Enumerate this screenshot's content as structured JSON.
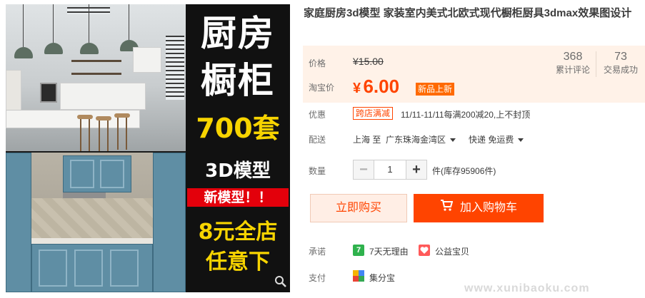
{
  "gallery": {
    "banner_line1": "厨房",
    "banner_line2": "橱柜",
    "banner_count": "700套",
    "banner_model": "3D模型",
    "banner_new": "新模型！！",
    "banner_sale1": "8元全店",
    "banner_sale2": "任意下"
  },
  "product": {
    "title": "家庭厨房3d模型 家装室内美式北欧式现代橱柜厨具3dmax效果图设计"
  },
  "price": {
    "label_price": "价格",
    "original": "¥15.00",
    "label_promo": "淘宝价",
    "promo_currency": "¥",
    "promo_value": "6.00",
    "new_badge": "新品上新",
    "reviews_count": "368",
    "reviews_label": "累计评论",
    "sales_count": "73",
    "sales_label": "交易成功"
  },
  "promotion": {
    "label": "优惠",
    "tag": "跨店满减",
    "desc": "11/11-11/11每满200减20,上不封顶"
  },
  "shipping": {
    "label": "配送",
    "from": "上海 至",
    "to": "广东珠海金湾区",
    "method": "快递 免运费"
  },
  "quantity": {
    "label": "数量",
    "minus": "−",
    "value": "1",
    "plus": "+",
    "stock": "件(库存95906件)"
  },
  "actions": {
    "buy_now": "立即购买",
    "add_cart": "加入购物车"
  },
  "services": {
    "promise_label": "承诺",
    "return_icon": "7",
    "return_text": "7天无理由",
    "charity_text": "公益宝贝",
    "pay_label": "支付",
    "pay_text": "集分宝"
  },
  "watermark": "www.xunibaoku.com",
  "colors": {
    "accent": "#ff4400",
    "price_bg": "#fff2e8",
    "banner_yellow": "#f7d400",
    "banner_red": "#e3000b"
  }
}
